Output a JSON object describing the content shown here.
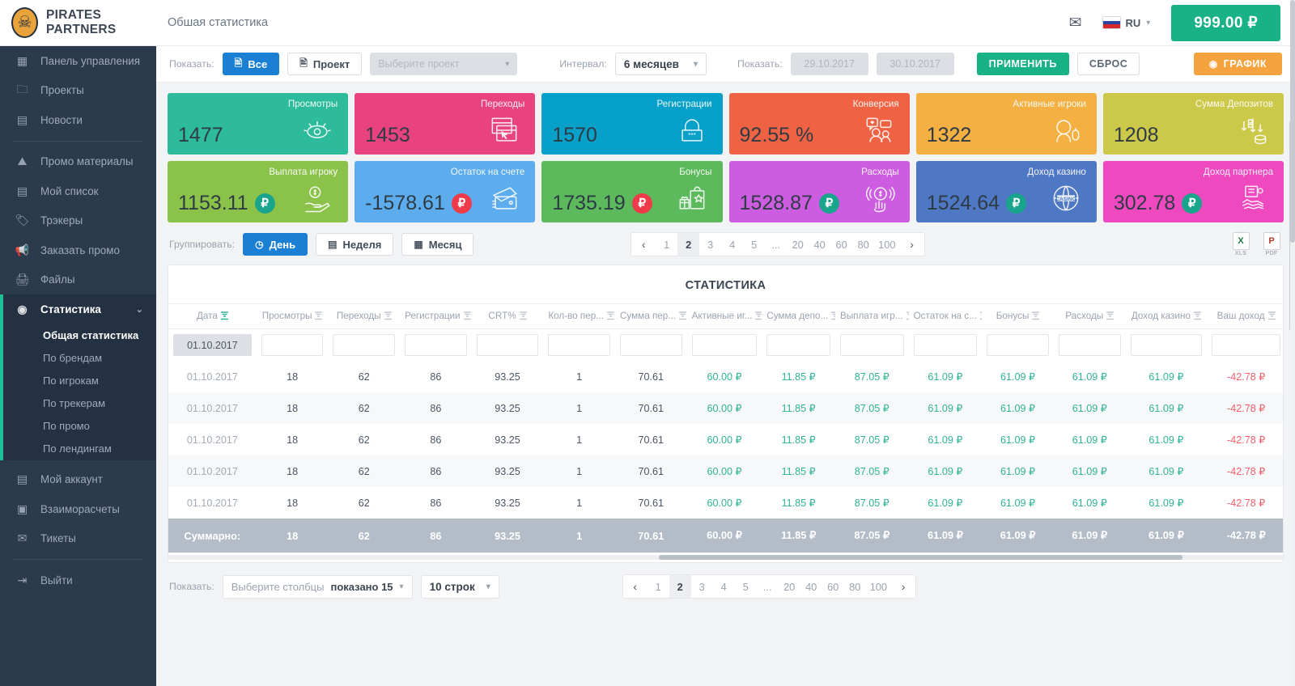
{
  "header": {
    "brand": "PIRATES PARTNERS",
    "subtitle": "Обшая статистика",
    "mail_icon": "✉",
    "lang": "RU",
    "balance": "999.00 ₽"
  },
  "sidebar": {
    "items": [
      {
        "label": "Панель управления",
        "icon": "▦"
      },
      {
        "label": "Проекты",
        "icon": "🗀"
      },
      {
        "label": "Новости",
        "icon": "▤"
      },
      {
        "label": "Промо материалы",
        "icon": "⛰"
      },
      {
        "label": "Мой список",
        "icon": "▤"
      },
      {
        "label": "Трэкеры",
        "icon": "🏷"
      },
      {
        "label": "Заказать промо",
        "icon": "📢"
      },
      {
        "label": "Файлы",
        "icon": "🖨"
      }
    ],
    "statistics": {
      "label": "Статистика",
      "icon": "◉",
      "chevron": "⌄",
      "children": [
        "Общая статистика",
        "По брендам",
        "По игрокам",
        "По трекерам",
        "По промо",
        "По лендингам"
      ]
    },
    "bottom_items": [
      {
        "label": "Мой аккаунт",
        "icon": "▤"
      },
      {
        "label": "Взаиморасчеты",
        "icon": "▣"
      },
      {
        "label": "Тикеты",
        "icon": "✉"
      }
    ],
    "logout": {
      "label": "Выйти",
      "icon": "⇥"
    }
  },
  "filters": {
    "show_label": "Показать:",
    "all_btn": "Все",
    "project_btn": "Проект",
    "project_select_placeholder": "Выберите проект",
    "interval_label": "Интервал:",
    "interval_value": "6 месяцев",
    "show_label2": "Показать:",
    "date_from": "29.10.2017",
    "date_to": "30.10.2017",
    "apply_btn": "ПРИМЕНИТЬ",
    "reset_btn": "СБРОС",
    "graph_btn": "ГРАФИК"
  },
  "cards": [
    {
      "title": "Просмотры",
      "value": "1477",
      "bg": "#2dbb9b",
      "icon": "eye-icon",
      "currency": false
    },
    {
      "title": "Переходы",
      "value": "1453",
      "bg": "#e8437e",
      "icon": "click-window-icon",
      "currency": false
    },
    {
      "title": "Регистрации",
      "value": "1570",
      "bg": "#06a0c8",
      "icon": "lock-icon",
      "currency": false
    },
    {
      "title": "Конверсия",
      "value": "92.55 %",
      "bg": "#ef6344",
      "icon": "users-chat-icon",
      "currency": false
    },
    {
      "title": "Активные игроки",
      "value": "1322",
      "bg": "#f4b042",
      "icon": "player-headset-icon",
      "currency": false
    },
    {
      "title": "Сумма Депозитов",
      "value": "1208",
      "bg": "#ccc84a",
      "icon": "deposit-arrows-icon",
      "currency": false
    },
    {
      "title": "Выплата игроку",
      "value": "1153.11",
      "bg": "#8bc council",
      "icon": "hand-coin-icon",
      "currency": true,
      "badge": "#19a48c"
    },
    {
      "title": "Остаток на счете",
      "value": "-1578.61",
      "bg": "#5cacee",
      "icon": "wallet-icon",
      "currency": true,
      "badge": "#ef3b49"
    },
    {
      "title": "Бонусы",
      "value": "1735.19",
      "bg": "#5cba5c",
      "icon": "gift-bag-icon",
      "currency": true,
      "badge": "#ef3b49"
    },
    {
      "title": "Расходы",
      "value": "1528.87",
      "bg": "#cc5ce0",
      "icon": "pay-tap-icon",
      "currency": true,
      "badge": "#19a48c"
    },
    {
      "title": "Доход казино",
      "value": "1524.64",
      "bg": "#4e77c4",
      "icon": "casino-icon",
      "currency": true,
      "badge": "#19a48c"
    },
    {
      "title": "Доход партнера",
      "value": "302.78",
      "bg": "#ef49c0",
      "icon": "handshake-icon",
      "currency": true,
      "badge": "#19a48c"
    }
  ],
  "card_rubles": "₽",
  "grouping": {
    "label": "Группировать:",
    "options": [
      {
        "label": "День",
        "icon": "◷",
        "active": true
      },
      {
        "label": "Неделя",
        "icon": "▤",
        "active": false
      },
      {
        "label": "Месяц",
        "icon": "▦",
        "active": false
      }
    ]
  },
  "pagination": {
    "prev": "‹",
    "next": "›",
    "pages": [
      "1",
      "2",
      "3",
      "4",
      "5",
      "...",
      "20",
      "40",
      "60",
      "80",
      "100"
    ],
    "current": "2"
  },
  "exports": [
    {
      "name": "xls-export",
      "glyph": "X",
      "tag": "XLS",
      "color": "#1d7144"
    },
    {
      "name": "pdf-export",
      "glyph": "P",
      "tag": "PDF",
      "color": "#c0392b"
    }
  ],
  "table": {
    "title": "СТАТИСТИКА",
    "columns": [
      "Дата",
      "Просмотры",
      "Переходы",
      "Регистрации",
      "CRT%",
      "Кол-во пер...",
      "Сумма пер...",
      "Активные иг...",
      "Сумма депо...",
      "Выплата игр...",
      "Остаток на с...",
      "Бонусы",
      "Расходы",
      "Доход казино",
      "Ваш доход"
    ],
    "filter_row_date": "01.10.2017",
    "rows": [
      {
        "cells": [
          "01.10.2017",
          "18",
          "62",
          "86",
          "93.25",
          "1",
          "70.61",
          "60.00 ₽",
          "11.85 ₽",
          "87.05 ₽",
          "61.09 ₽",
          "61.09 ₽",
          "61.09 ₽",
          "61.09 ₽",
          "-42.78 ₽"
        ]
      },
      {
        "cells": [
          "01.10.2017",
          "18",
          "62",
          "86",
          "93.25",
          "1",
          "70.61",
          "60.00 ₽",
          "11.85 ₽",
          "87.05 ₽",
          "61.09 ₽",
          "61.09 ₽",
          "61.09 ₽",
          "61.09 ₽",
          "-42.78 ₽"
        ]
      },
      {
        "cells": [
          "01.10.2017",
          "18",
          "62",
          "86",
          "93.25",
          "1",
          "70.61",
          "60.00 ₽",
          "11.85 ₽",
          "87.05 ₽",
          "61.09 ₽",
          "61.09 ₽",
          "61.09 ₽",
          "61.09 ₽",
          "-42.78 ₽"
        ]
      },
      {
        "cells": [
          "01.10.2017",
          "18",
          "62",
          "86",
          "93.25",
          "1",
          "70.61",
          "60.00 ₽",
          "11.85 ₽",
          "87.05 ₽",
          "61.09 ₽",
          "61.09 ₽",
          "61.09 ₽",
          "61.09 ₽",
          "-42.78 ₽"
        ]
      },
      {
        "cells": [
          "01.10.2017",
          "18",
          "62",
          "86",
          "93.25",
          "1",
          "70.61",
          "60.00 ₽",
          "11.85 ₽",
          "87.05 ₽",
          "61.09 ₽",
          "61.09 ₽",
          "61.09 ₽",
          "61.09 ₽",
          "-42.78 ₽"
        ]
      }
    ],
    "total": {
      "label": "Суммарно:",
      "cells": [
        "18",
        "62",
        "86",
        "93.25",
        "1",
        "70.61",
        "60.00 ₽",
        "11.85 ₽",
        "87.05 ₽",
        "61.09 ₽",
        "61.09 ₽",
        "61.09 ₽",
        "61.09 ₽",
        "-42.78 ₽"
      ]
    }
  },
  "bottom": {
    "show_label": "Показать:",
    "columns_select_placeholder": "Выберите столбцы",
    "columns_select_value": "показано 15",
    "rows_select_value": "10 строк"
  },
  "colors": {
    "accent_blue": "#1b7fd4",
    "accent_green": "#19b186",
    "accent_orange": "#f5a33f",
    "sidebar_bg": "#2b3a4c",
    "positive": "#2fb395",
    "negative": "#ef5f6b"
  }
}
